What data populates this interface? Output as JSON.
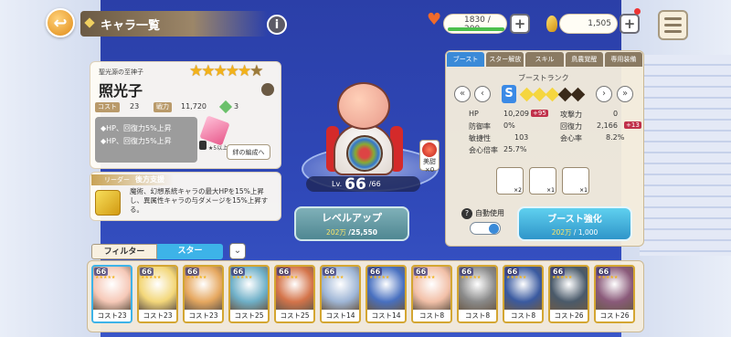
{
  "header": {
    "title": "キャラ一覧",
    "stamina": "1830 / 200",
    "currency": "1,505",
    "back_icon": "back-arrow-icon",
    "info_icon": "info-icon",
    "menu_icon": "hamburger-icon"
  },
  "character": {
    "subtitle": "聖光源の至神子",
    "name": "照光子",
    "stars": 5,
    "cost_label": "コスト",
    "cost_value": "23",
    "power_label": "戦力",
    "power_value": "11,720",
    "gem_count": "3",
    "skills": [
      "◆HP、回復力5%上昇",
      "◆HP、回復力5%上昇"
    ],
    "requirement": "★5以上",
    "kizuna_button": "絆の編成へ",
    "level_label": "Lv.",
    "level": "66",
    "level_max": "/66",
    "badge_label": "美甜",
    "badge_count": "×0"
  },
  "leader": {
    "label": "リーダー",
    "title": "後方支援",
    "description": "魔術、幻想系統キャラの最大HPを15%上昇し、異属性キャラの与ダメージを15%上昇する。"
  },
  "levelup": {
    "label": "レベルアップ",
    "cost_current": "202万",
    "cost_total": "/25,550"
  },
  "boost_panel": {
    "tabs": [
      "ブースト",
      "スター解放",
      "スキル",
      "鳥農覚醒",
      "専用装備"
    ],
    "rank_label": "ブーストランク",
    "rank_grade": "S",
    "stats": [
      {
        "label": "HP",
        "value": "10,209",
        "bonus": "+95",
        "label2": "攻撃力",
        "value2": "0",
        "bonus2": ""
      },
      {
        "label": "防御率",
        "value": "0%",
        "bonus": "",
        "label2": "回復力",
        "value2": "2,166",
        "bonus2": "+13"
      },
      {
        "label": "敏捷性",
        "value": "103",
        "bonus": "",
        "label2": "会心率",
        "value2": "8.2%",
        "bonus2": ""
      },
      {
        "label": "会心倍率",
        "value": "25.7%",
        "bonus": "",
        "label2": "",
        "value2": "",
        "bonus2": ""
      }
    ],
    "skill_counts": [
      "×2",
      "×1",
      "×1"
    ],
    "auto_label": "自動使用",
    "boost_button": "ブースト強化",
    "boost_cost_current": "202万",
    "boost_cost_total": "/ 1,000"
  },
  "filter": {
    "filter_label": "フィルター",
    "star_label": "スター"
  },
  "roster": [
    {
      "lv": "66",
      "cost": "コスト23",
      "color": "#f6c9b8"
    },
    {
      "lv": "66",
      "cost": "コスト23",
      "color": "#f3d77a"
    },
    {
      "lv": "66",
      "cost": "コスト23",
      "color": "#e6a860"
    },
    {
      "lv": "66",
      "cost": "コスト25",
      "color": "#6fb0c8"
    },
    {
      "lv": "66",
      "cost": "コスト25",
      "color": "#d4744a"
    },
    {
      "lv": "66",
      "cost": "コスト14",
      "color": "#9fb6d6"
    },
    {
      "lv": "66",
      "cost": "コスト14",
      "color": "#4870c0"
    },
    {
      "lv": "66",
      "cost": "コスト8",
      "color": "#f2c0a8"
    },
    {
      "lv": "66",
      "cost": "コスト8",
      "color": "#8a8a8a"
    },
    {
      "lv": "66",
      "cost": "コスト8",
      "color": "#3a5aa0"
    },
    {
      "lv": "66",
      "cost": "コスト26",
      "color": "#4a5a6a"
    },
    {
      "lv": "66",
      "cost": "コスト26",
      "color": "#8a5a7a"
    }
  ]
}
